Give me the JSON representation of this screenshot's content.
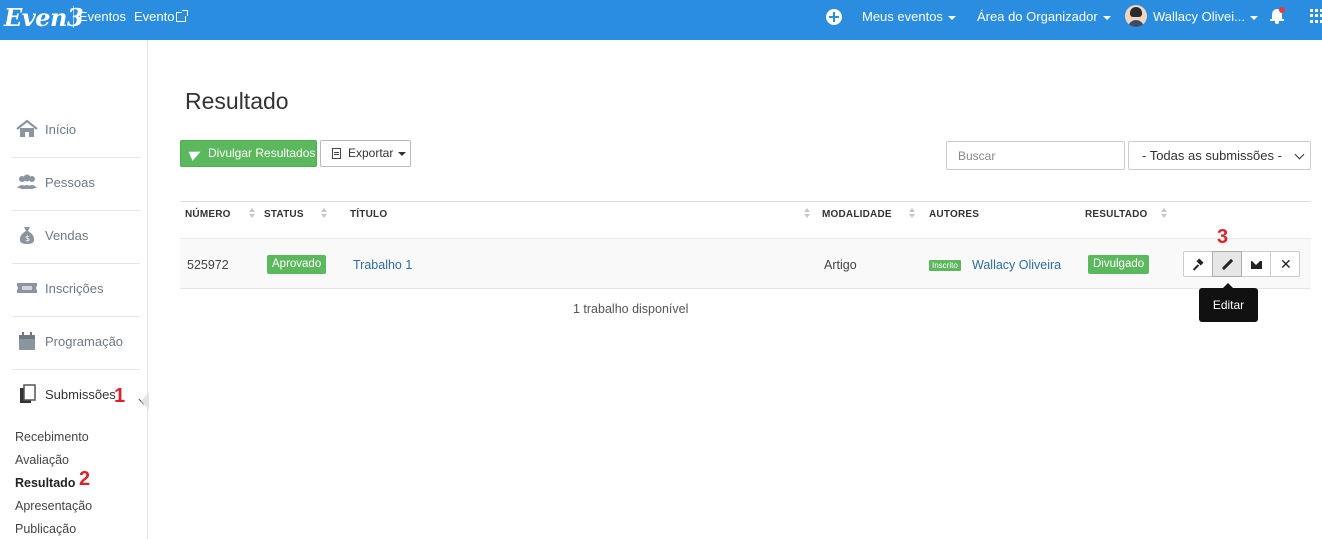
{
  "topbar": {
    "logo": "Even3",
    "eventos": "Eventos",
    "evento": "Evento",
    "meus_eventos": "Meus eventos",
    "area_organizador": "Área do Organizador",
    "user_name": "Wallacy Olivei..."
  },
  "sidebar": {
    "items": [
      {
        "label": "Início",
        "icon": "home-icon"
      },
      {
        "label": "Pessoas",
        "icon": "people-icon"
      },
      {
        "label": "Vendas",
        "icon": "money-bag-icon"
      },
      {
        "label": "Inscrições",
        "icon": "ticket-icon"
      },
      {
        "label": "Programação",
        "icon": "calendar-icon"
      },
      {
        "label": "Submissões",
        "icon": "documents-icon"
      }
    ],
    "sub_items": [
      "Recebimento",
      "Avaliação",
      "Resultado",
      "Apresentação",
      "Publicação"
    ],
    "markers": {
      "submissoes": "1",
      "resultado": "2",
      "editar": "3"
    }
  },
  "main": {
    "title": "Resultado",
    "divulgar_label": "Divulgar Resultados",
    "exportar_label": "Exportar",
    "search_placeholder": "Buscar",
    "filter_selected": "- Todas as submissões -"
  },
  "table": {
    "headers": [
      "NÚMERO",
      "STATUS",
      "TÍTULO",
      "MODALIDADE",
      "AUTORES",
      "RESULTADO"
    ],
    "rows": [
      {
        "numero": "525972",
        "status": "Aprovado",
        "titulo": "Trabalho 1",
        "modalidade": "Artigo",
        "autor_badge": "Inscrito",
        "autor": "Wallacy Oliveira",
        "resultado": "Divulgado"
      }
    ],
    "tooltip": "Editar",
    "footer": "1 trabalho disponível"
  },
  "colors": {
    "topbar": "#2b8de0",
    "success": "#5cb85c",
    "marker": "#d9252a",
    "link": "#2d6da3"
  }
}
